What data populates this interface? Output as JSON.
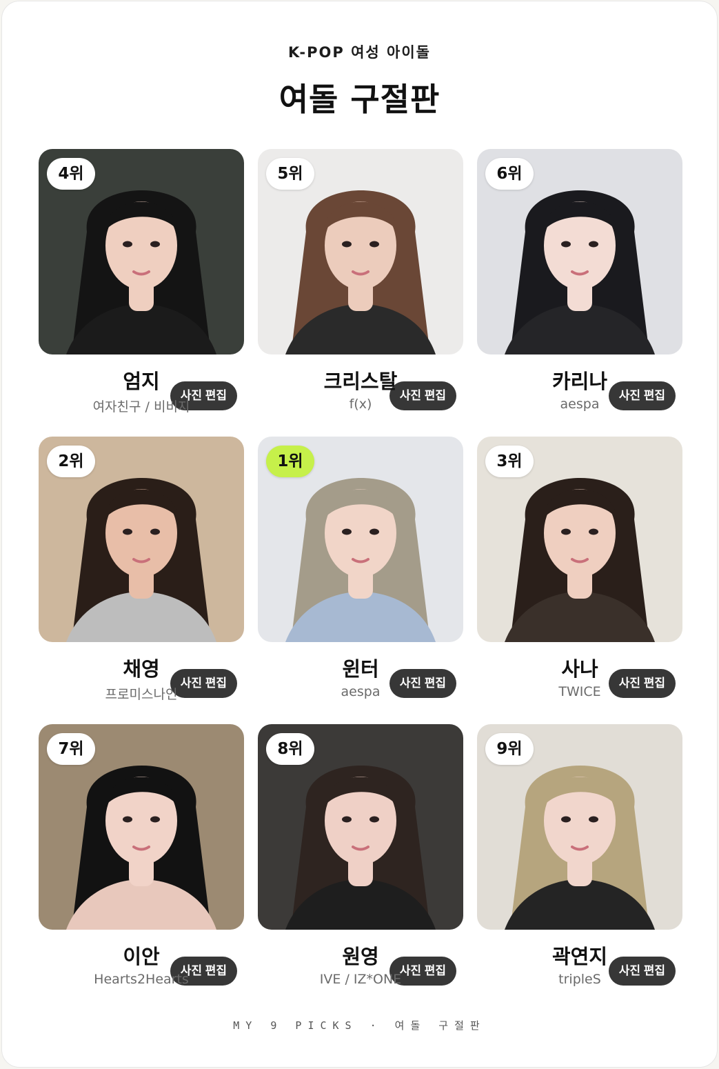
{
  "header": {
    "eyebrow": "K-POP 여성 아이돌",
    "title": "여돌 구절판"
  },
  "edit_label": "사진 편집",
  "tiles": [
    {
      "rank": "4위",
      "name": "엄지",
      "group": "여자친구 / 비비지",
      "top": false,
      "palette": {
        "bg": "#3a3f3a",
        "hair": "#141414",
        "skin": "#efcfc0",
        "cloth": "#1b1b1b"
      }
    },
    {
      "rank": "5위",
      "name": "크리스탈",
      "group": "f(x)",
      "top": false,
      "palette": {
        "bg": "#ecebea",
        "hair": "#6a4736",
        "skin": "#ecccbc",
        "cloth": "#2a2a2a"
      }
    },
    {
      "rank": "6위",
      "name": "카리나",
      "group": "aespa",
      "top": false,
      "palette": {
        "bg": "#dfe0e4",
        "hair": "#1a1a1e",
        "skin": "#f3dcd4",
        "cloth": "#252528"
      }
    },
    {
      "rank": "2위",
      "name": "채영",
      "group": "프로미스나인",
      "top": false,
      "palette": {
        "bg": "#cdb79d",
        "hair": "#2a1e18",
        "skin": "#e8bea8",
        "cloth": "#bdbdbd"
      }
    },
    {
      "rank": "1위",
      "name": "윈터",
      "group": "aespa",
      "top": true,
      "palette": {
        "bg": "#e4e6ea",
        "hair": "#a49c8a",
        "skin": "#f1d5c8",
        "cloth": "#a7b9d2"
      }
    },
    {
      "rank": "3위",
      "name": "사나",
      "group": "TWICE",
      "top": false,
      "palette": {
        "bg": "#e6e2da",
        "hair": "#2a1f1a",
        "skin": "#efcfc0",
        "cloth": "#3a302a"
      }
    },
    {
      "rank": "7위",
      "name": "이안",
      "group": "Hearts2Hearts",
      "top": false,
      "palette": {
        "bg": "#9c8a72",
        "hair": "#121212",
        "skin": "#f1d3c8",
        "cloth": "#e8c8bc"
      }
    },
    {
      "rank": "8위",
      "name": "원영",
      "group": "IVE / IZ*ONE",
      "top": false,
      "palette": {
        "bg": "#3c3a38",
        "hair": "#2e2420",
        "skin": "#efd0c6",
        "cloth": "#1e1e1e"
      }
    },
    {
      "rank": "9위",
      "name": "곽연지",
      "group": "tripleS",
      "top": false,
      "palette": {
        "bg": "#e1ddd6",
        "hair": "#b6a57e",
        "skin": "#f1d6cc",
        "cloth": "#242424"
      }
    }
  ],
  "footer": "MY 9 PICKS · 여돌 구절판"
}
